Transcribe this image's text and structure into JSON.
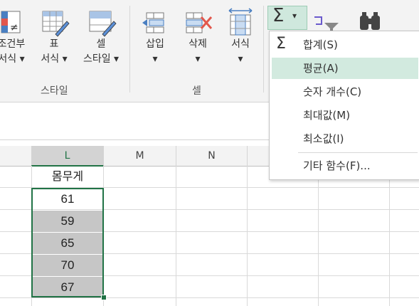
{
  "ribbon": {
    "buttons": [
      {
        "label1": "조건부",
        "label2": "서식 ▾"
      },
      {
        "label1": "표",
        "label2": "서식 ▾"
      },
      {
        "label1": "셀",
        "label2": "스타일 ▾"
      },
      {
        "label1": "삽입",
        "label2": "▾"
      },
      {
        "label1": "삭제",
        "label2": "▾"
      },
      {
        "label1": "서식",
        "label2": "▾"
      }
    ],
    "groups": {
      "styles": "스타일",
      "cells": "셀"
    },
    "autosum_caret": "▾"
  },
  "sum_menu": {
    "items": [
      {
        "label": "합계(S)",
        "icon": "sigma-icon"
      },
      {
        "label": "평균(A)"
      },
      {
        "label": "숫자 개수(C)"
      },
      {
        "label": "최대값(M)"
      },
      {
        "label": "최소값(I)"
      },
      {
        "label": "기타 함수(F)..."
      }
    ],
    "sigma_glyph": "Σ"
  },
  "grid": {
    "columns": [
      "L",
      "M",
      "N"
    ],
    "cells": [
      "몸무게",
      "61",
      "59",
      "65",
      "70",
      "67"
    ]
  },
  "colors": {
    "accent": "#217346",
    "highlight": "#d2eadf",
    "selected_fill": "#c6c6c6"
  }
}
